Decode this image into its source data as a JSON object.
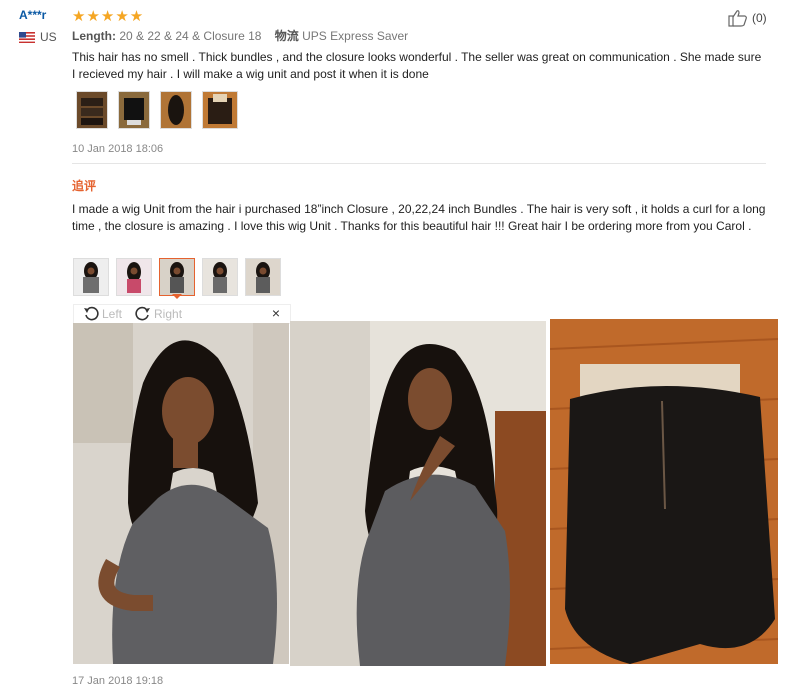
{
  "review1": {
    "user": "A***r",
    "country": "US",
    "stars": "★★★★★",
    "length_label": "Length:",
    "length_value": "20 & 22 & 24 & Closure 18",
    "ship_label": "物流",
    "ship_value": "UPS Express Saver",
    "helpful": "(0)",
    "text": "This hair has no smell . Thick bundles , and the closure looks wonderful . The seller was great on communication . She made sure I recieved my hair . I will make a wig unit and post it when it is done",
    "date": "10 Jan 2018 18:06"
  },
  "additional": {
    "label": "追评",
    "text": "I made a wig Unit from the hair i purchased 18”inch Closure , 20,22,24 inch Bundles . The hair is very soft , it holds a curl for a long time , the closure is amazing . I love this wig Unit . Thanks for this beautiful hair !!! Great hair I be ordering more from you Carol .",
    "date": "17 Jan 2018 19:18"
  },
  "viewer": {
    "left_label": "Left",
    "right_label": "Right",
    "close": "×"
  },
  "colors": {
    "accent": "#e5622f",
    "star": "#f5a623",
    "user": "#0b59a4"
  }
}
